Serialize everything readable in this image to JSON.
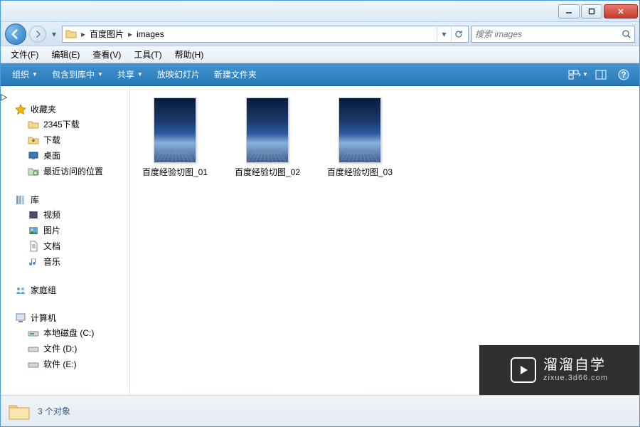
{
  "titlebar": {
    "min": "–",
    "max": "▢",
    "close": "✕"
  },
  "nav": {
    "crumb1": "百度图片",
    "crumb2": "images",
    "search_placeholder": "搜索 images"
  },
  "menu": {
    "file": "文件(F)",
    "edit": "编辑(E)",
    "view": "查看(V)",
    "tools": "工具(T)",
    "help": "帮助(H)"
  },
  "toolbar": {
    "organize": "组织",
    "include": "包含到库中",
    "share": "共享",
    "slideshow": "放映幻灯片",
    "newfolder": "新建文件夹"
  },
  "sidebar": {
    "favorites": "收藏夹",
    "fav_items": [
      "2345下载",
      "下载",
      "桌面",
      "最近访问的位置"
    ],
    "library": "库",
    "lib_items": [
      "视频",
      "图片",
      "文档",
      "音乐"
    ],
    "homegroup": "家庭组",
    "computer": "计算机",
    "comp_items": [
      "本地磁盘 (C:)",
      "文件 (D:)",
      "软件 (E:)"
    ]
  },
  "files": [
    {
      "name": "百度经验切图_01"
    },
    {
      "name": "百度经验切图_02"
    },
    {
      "name": "百度经验切图_03"
    }
  ],
  "status": {
    "count": "3 个对象"
  },
  "watermark": {
    "line1": "溜溜自学",
    "line2": "zixue.3d66.com"
  }
}
